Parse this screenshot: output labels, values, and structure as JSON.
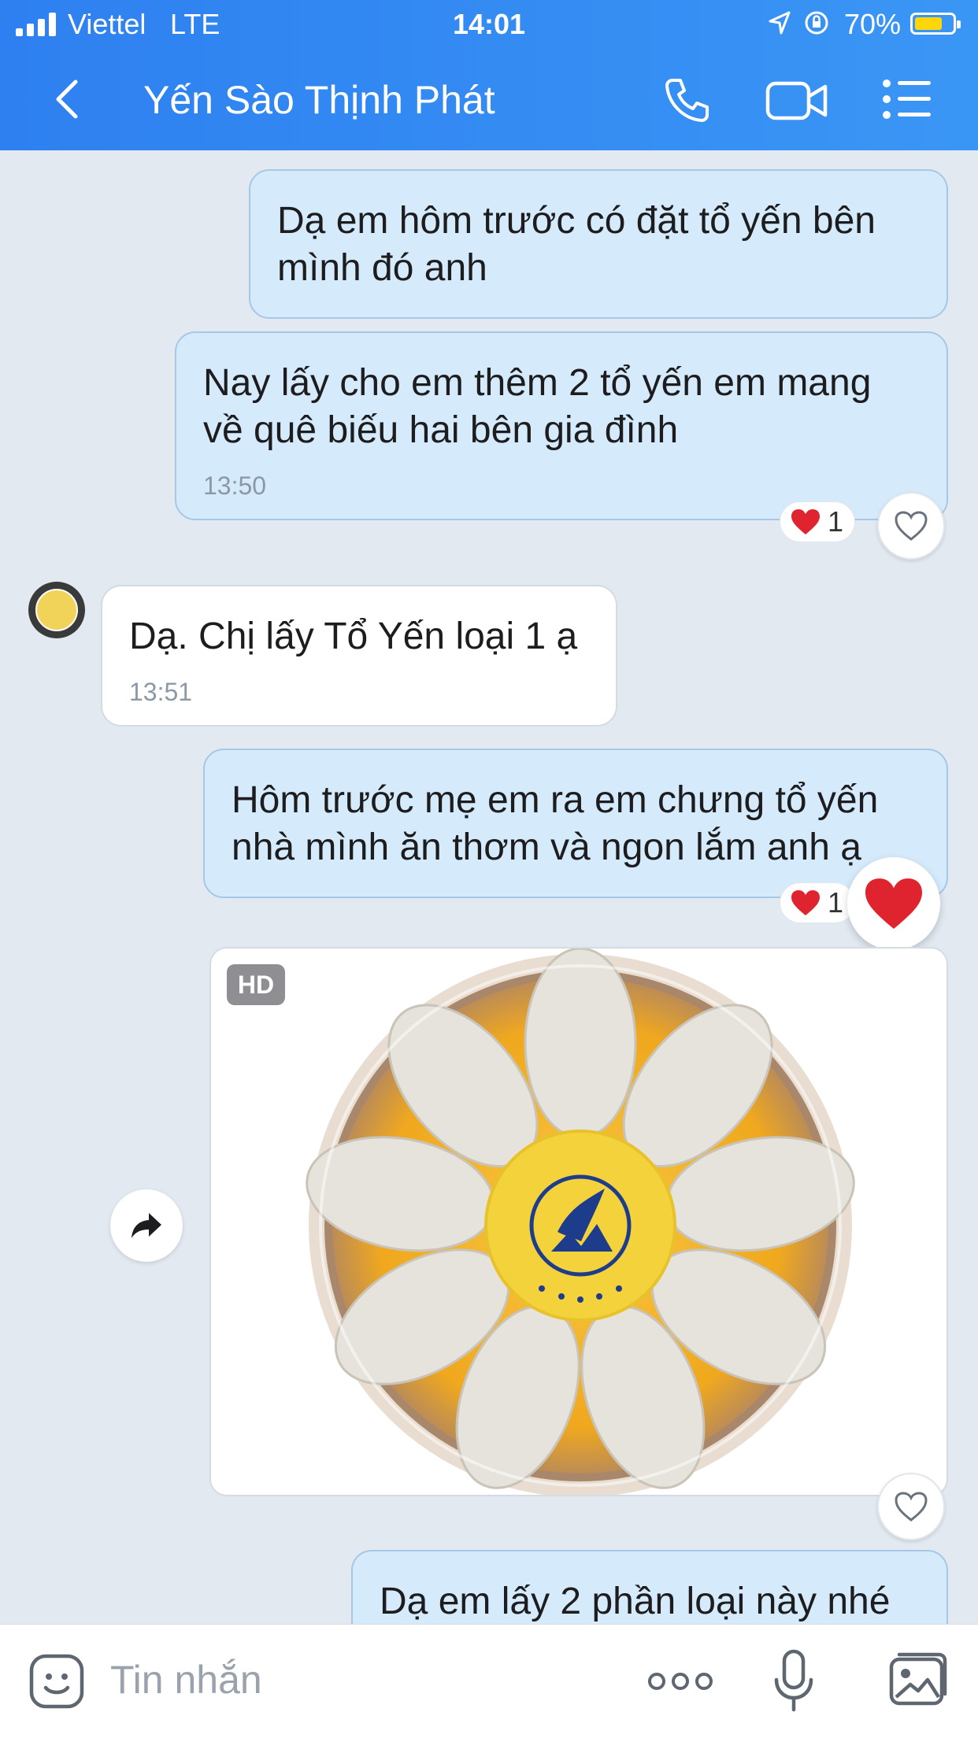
{
  "status_bar": {
    "carrier": "Viettel",
    "network": "LTE",
    "time": "14:01",
    "battery_percent": "70%"
  },
  "header": {
    "title": "Yến Sào Thịnh Phát",
    "back_icon": "chevron-left-icon",
    "call_icon": "phone-icon",
    "video_icon": "video-camera-icon",
    "menu_icon": "list-menu-icon"
  },
  "messages": [
    {
      "direction": "out",
      "text": "Dạ em hôm trước có đặt tổ yến bên\nmình đó anh"
    },
    {
      "direction": "out",
      "text": "Nay lấy cho em thêm 2 tổ yến em mang\nvề quê biếu hai bên gia đình",
      "time": "13:50",
      "reaction_count": "1"
    },
    {
      "direction": "in",
      "text": "Dạ. Chị lấy Tổ Yến loại 1 ạ",
      "time": "13:51"
    },
    {
      "direction": "out",
      "text": "Hôm trước mẹ em ra em chưng tổ yến\nnhà mình ăn thơm và ngon lắm anh ạ",
      "reaction_count": "1"
    },
    {
      "direction": "out",
      "type": "image",
      "badge": "HD",
      "image_desc": "bird nest product"
    },
    {
      "direction": "out",
      "text": "Dạ em lấy 2 phần loại này nhé"
    }
  ],
  "composer": {
    "placeholder": "Tin nhắn"
  },
  "colors": {
    "header": "#2e80f0",
    "outgoing_bubble": "#d5eafb",
    "incoming_bubble": "#ffffff",
    "reaction_heart": "#e0242f"
  }
}
